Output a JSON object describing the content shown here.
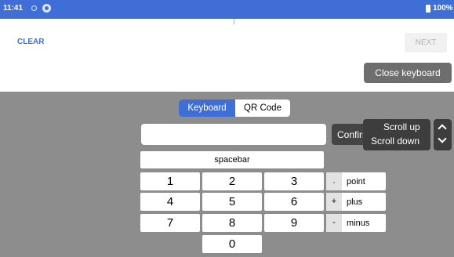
{
  "status_bar": {
    "time": "11:41",
    "battery": "100%"
  },
  "top": {
    "clear_label": "CLEAR",
    "next_label": "NEXT",
    "close_keyboard_label": "Close keyboard"
  },
  "keyboard": {
    "tabs": {
      "keyboard": "Keyboard",
      "qr": "QR Code"
    },
    "input_value": "",
    "confirm_label": "Confirm",
    "scroll_up_label": "Scroll up",
    "scroll_down_label": "Scroll down",
    "spacebar_label": "spacebar",
    "keys": [
      "1",
      "2",
      "3",
      "4",
      "5",
      "6",
      "7",
      "8",
      "9",
      "0"
    ],
    "ops": [
      {
        "symbol": ".",
        "label": "point"
      },
      {
        "symbol": "+",
        "label": "plus"
      },
      {
        "symbol": "-",
        "label": "minus"
      }
    ]
  },
  "colors": {
    "accent": "#3f6fd6",
    "panel": "#8d8d8d",
    "dark_button": "#444444",
    "scroll_box": "#3d3d3d"
  }
}
